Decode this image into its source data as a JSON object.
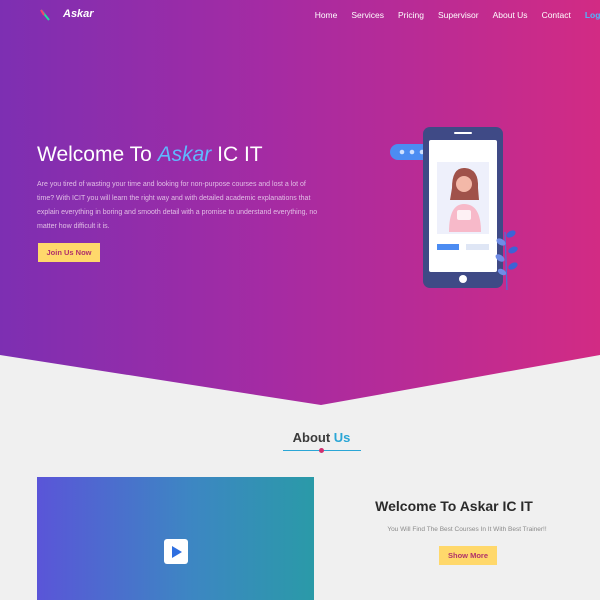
{
  "brand": {
    "name": "Askar"
  },
  "nav": {
    "items": [
      "Home",
      "Services",
      "Pricing",
      "Supervisor",
      "About Us",
      "Contact"
    ],
    "login": "Login"
  },
  "hero": {
    "title_prefix": "Welcome To ",
    "title_highlight": "Askar",
    "title_suffix": " IC IT",
    "text": "Are you tired of wasting your time and looking for non-purpose courses and lost a lot of time? With ICIT you will learn the right way and with detailed academic explanations that explain everything in boring and smooth detail with a promise to understand everything, no matter how difficult it is.",
    "cta": "Join Us Now"
  },
  "about": {
    "title_prefix": "About ",
    "title_highlight": "Us",
    "welcome_title": "Welcome To Askar IC IT",
    "welcome_sub": "You Will Find The Best Courses In It  With Best Trainer!!",
    "cta": "Show More"
  },
  "colors": {
    "gradient_start": "#7d2fb2",
    "gradient_end": "#d22b84",
    "accent_blue": "#4fb7ff",
    "button_yellow": "#ffd86b"
  }
}
